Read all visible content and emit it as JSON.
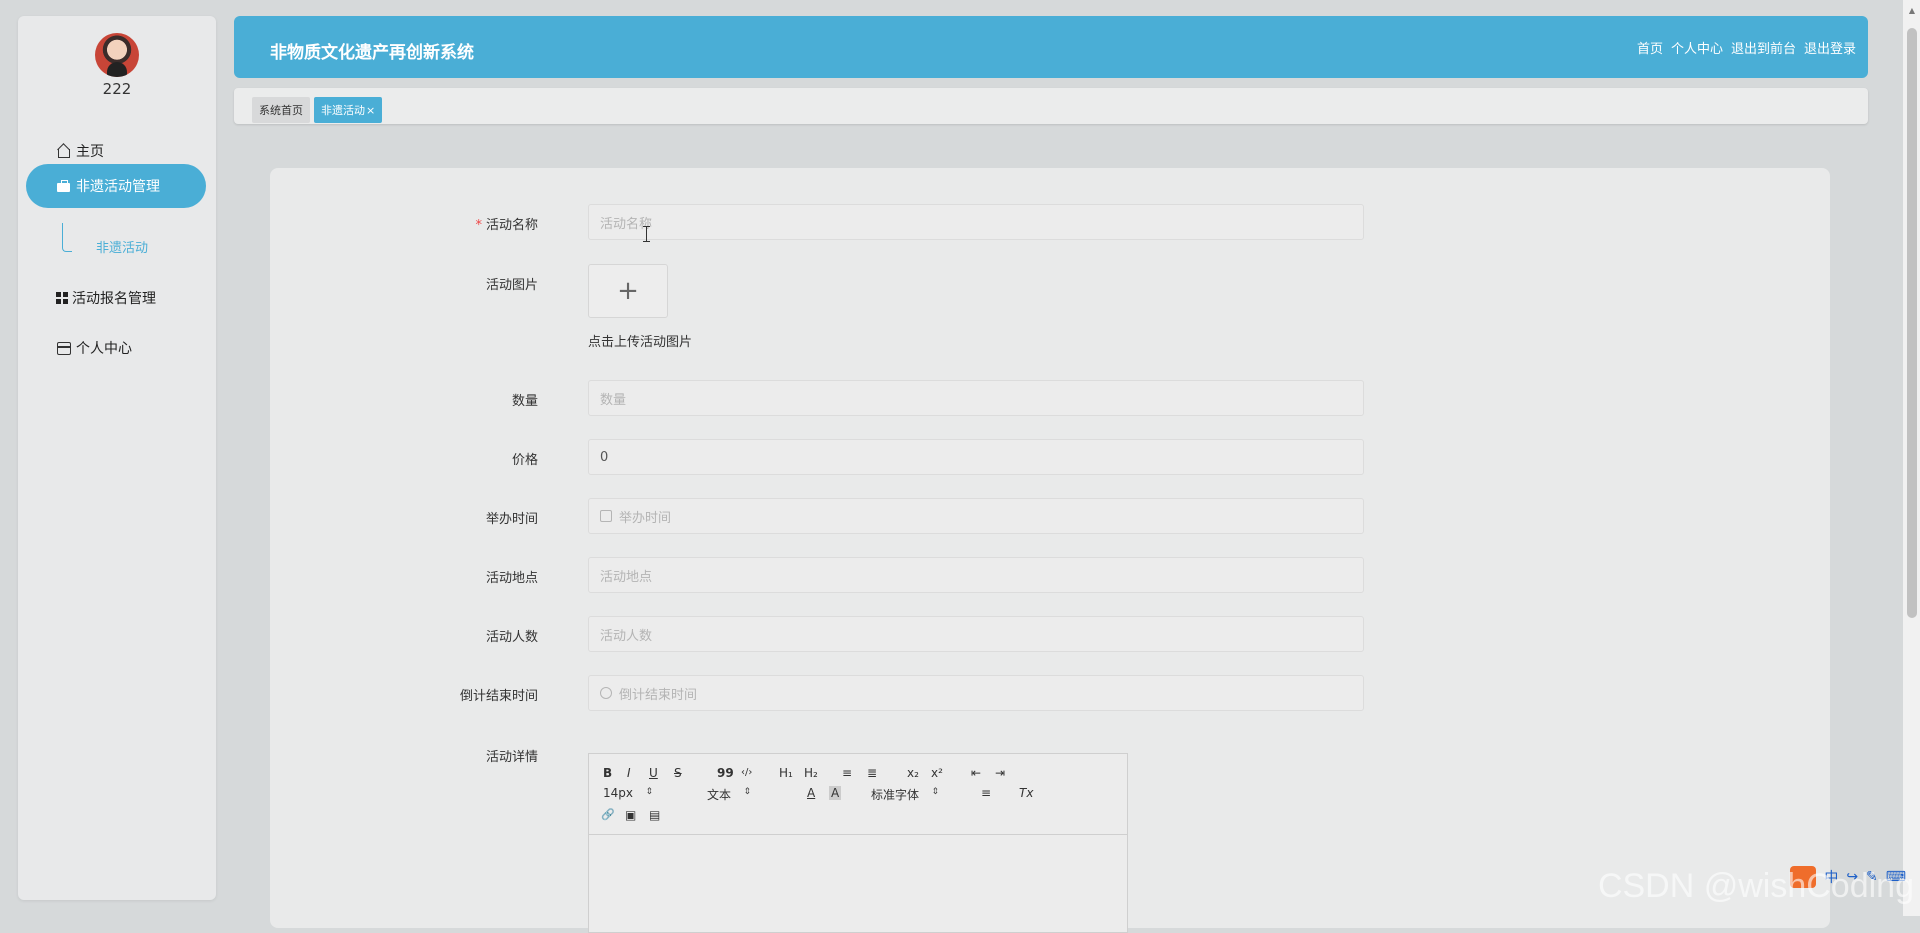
{
  "sidebar": {
    "username": "222",
    "menu": [
      {
        "label": "主页",
        "icon": "home-icon"
      },
      {
        "label": "非遗活动管理",
        "icon": "bag-icon"
      },
      {
        "label": "活动报名管理",
        "icon": "grid-icon"
      },
      {
        "label": "个人中心",
        "icon": "card-icon"
      }
    ],
    "submenu": {
      "label": "非遗活动"
    }
  },
  "header": {
    "title": "非物质文化遗产再创新系统",
    "links": [
      "首页",
      "个人中心",
      "退出到前台",
      "退出登录"
    ]
  },
  "tabs": [
    {
      "label": "系统首页"
    },
    {
      "label": "非遗活动",
      "close": "×"
    }
  ],
  "form": {
    "required_mark": "*",
    "name": {
      "label": "活动名称",
      "placeholder": "活动名称"
    },
    "image": {
      "label": "活动图片",
      "plus": "+",
      "hint": "点击上传活动图片"
    },
    "quantity": {
      "label": "数量",
      "placeholder": "数量"
    },
    "price": {
      "label": "价格",
      "value": "0"
    },
    "time": {
      "label": "举办时间",
      "placeholder": "举办时间"
    },
    "location": {
      "label": "活动地点",
      "placeholder": "活动地点"
    },
    "people": {
      "label": "活动人数",
      "placeholder": "活动人数"
    },
    "countdown": {
      "label": "倒计结束时间",
      "placeholder": "倒计结束时间"
    },
    "detail": {
      "label": "活动详情"
    }
  },
  "editor": {
    "bold": "B",
    "italic": "I",
    "underline": "U",
    "strike": "S",
    "quote": "99",
    "code": "‹/›",
    "h1": "H₁",
    "h2": "H₂",
    "ordered": "≡",
    "bullet": "≣",
    "sub": "x₂",
    "sup": "x²",
    "outdent": "⇤",
    "indent": "⇥",
    "size": "14px",
    "text": "文本",
    "color": "A",
    "bg": "A",
    "font": "标准字体",
    "align": "≡",
    "clear": "Tx",
    "link": "🔗",
    "image": "▣",
    "video": "▤"
  },
  "watermark": "CSDN @wishCoding",
  "ime": [
    "中",
    "↪",
    "✎",
    "⌨"
  ]
}
